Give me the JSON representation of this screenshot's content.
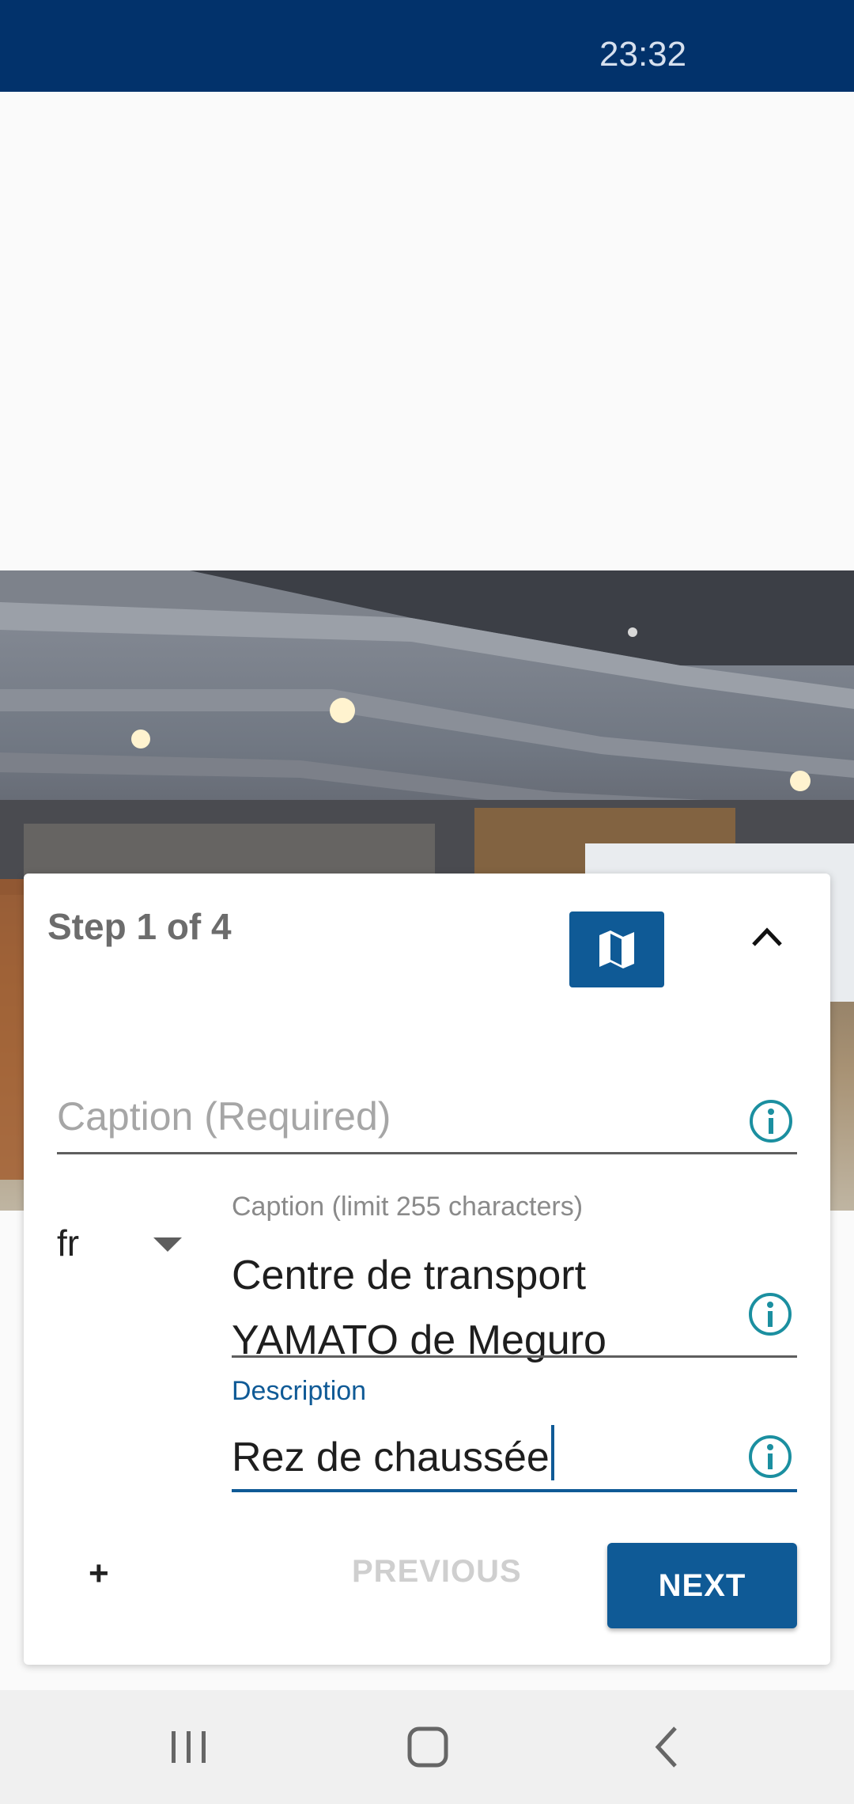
{
  "status_bar": {
    "time": "23:32"
  },
  "step_card": {
    "step_label": "Step 1 of 4",
    "map_icon": "map-icon",
    "collapse_icon": "chevron-up-icon",
    "caption_required": {
      "placeholder": "Caption (Required)",
      "info_icon": "info-icon"
    },
    "language": {
      "selected": "fr",
      "icon": "dropdown-caret-icon"
    },
    "caption_field": {
      "label": "Caption (limit 255 characters)",
      "line1": "Centre de transport",
      "line2": "YAMATO de Meguro",
      "info_icon": "info-icon"
    },
    "description_field": {
      "label": "Description",
      "value": "Rez de chaussée",
      "info_icon": "info-icon"
    },
    "add_label": "+",
    "previous_label": "PREVIOUS",
    "next_label": "NEXT"
  },
  "colors": {
    "status_bar": "#02326b",
    "primary": "#0f5a96",
    "info_icon": "#1b8fa0"
  },
  "nav_bar": {
    "recents_icon": "recents-icon",
    "home_icon": "home-icon",
    "back_icon": "back-icon"
  }
}
